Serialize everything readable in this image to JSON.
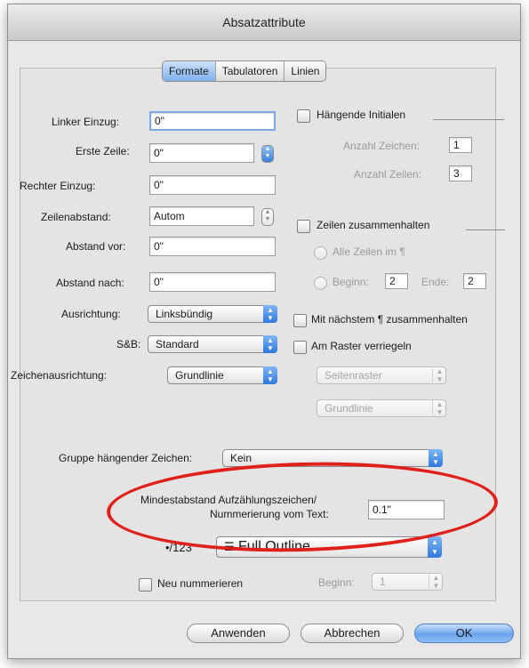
{
  "window": {
    "title": "Absatzattribute"
  },
  "tabs": [
    "Formate",
    "Tabulatoren",
    "Linien"
  ],
  "left": {
    "linker_einzug": {
      "label": "Linker Einzug:",
      "value": "0\""
    },
    "erste_zeile": {
      "label": "Erste Zeile:",
      "value": "0\""
    },
    "rechter_einzug": {
      "label": "Rechter Einzug:",
      "value": "0\""
    },
    "zeilenabstand": {
      "label": "Zeilenabstand:",
      "value": "Autom"
    },
    "abstand_vor": {
      "label": "Abstand vor:",
      "value": "0\""
    },
    "abstand_nach": {
      "label": "Abstand nach:",
      "value": "0\""
    },
    "ausrichtung": {
      "label": "Ausrichtung:",
      "value": "Linksbündig"
    },
    "sb": {
      "label": "S&B:",
      "value": "Standard"
    },
    "zeichenausrichtung": {
      "label": "Zeichenausrichtung:",
      "value": "Grundlinie"
    }
  },
  "right": {
    "haengende_initialen": "Hängende Initialen",
    "anzahl_zeichen": {
      "label": "Anzahl Zeichen:",
      "value": "1"
    },
    "anzahl_zeilen": {
      "label": "Anzahl Zeilen:",
      "value": "3"
    },
    "zeilen_zusammenhalten": "Zeilen zusammenhalten",
    "alle_zeilen": "Alle Zeilen im ¶",
    "beginn": {
      "label": "Beginn:",
      "value": "2"
    },
    "ende": {
      "label": "Ende:",
      "value": "2"
    },
    "mit_naechstem": "Mit nächstem ¶ zusammenhalten",
    "am_raster": "Am Raster verriegeln",
    "seitenraster": "Seitenraster",
    "grundlinie": "Grundlinie"
  },
  "bottom": {
    "gruppe": {
      "label": "Gruppe hängender Zeichen:",
      "value": "Kein"
    },
    "mindestabstand": {
      "label_line1": "Mindestabstand Aufzählungszeichen/",
      "label_line2": "Nummerierung vom Text:",
      "value": "0.1\""
    },
    "bullets": {
      "label": "•/123",
      "value": "Full Outline"
    },
    "neu_nummerieren": "Neu nummerieren",
    "beginn": {
      "label": "Beginn:",
      "value": "1"
    }
  },
  "buttons": {
    "apply": "Anwenden",
    "cancel": "Abbrechen",
    "ok": "OK"
  },
  "colors": {
    "highlight": "#e0201b",
    "accent": "#3a82e0"
  }
}
